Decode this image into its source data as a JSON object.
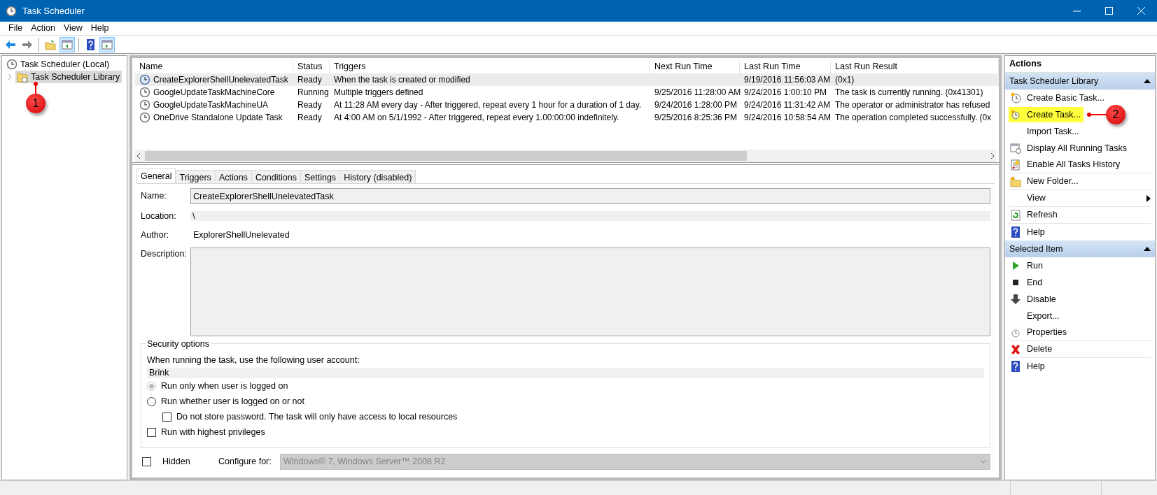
{
  "window": {
    "title": "Task Scheduler"
  },
  "menu": [
    "File",
    "Action",
    "View",
    "Help"
  ],
  "toolbar": [
    {
      "kind": "back",
      "on": false
    },
    {
      "kind": "forward",
      "on": false
    },
    {
      "kind": "sep"
    },
    {
      "kind": "up",
      "on": false
    },
    {
      "kind": "tree-pane",
      "on": true
    },
    {
      "kind": "sep"
    },
    {
      "kind": "help",
      "on": false
    },
    {
      "kind": "action-pane",
      "on": true
    }
  ],
  "tree": [
    {
      "label": "Task Scheduler (Local)",
      "selected": false,
      "children": [
        {
          "label": "Task Scheduler Library",
          "selected": true,
          "expanded": false,
          "callout": "1"
        }
      ]
    }
  ],
  "tasks": {
    "columns": [
      "Name",
      "Status",
      "Triggers",
      "Next Run Time",
      "Last Run Time",
      "Last Run Result"
    ],
    "rows": [
      {
        "selected": true,
        "cells": [
          "CreateExplorerShellUnelevatedTask",
          "Ready",
          "When the task is created or modified",
          "",
          "9/19/2016 11:56:03 AM",
          "(0x1)"
        ]
      },
      {
        "selected": false,
        "cells": [
          "GoogleUpdateTaskMachineCore",
          "Running",
          "Multiple triggers defined",
          "9/25/2016 11:28:00 AM",
          "9/24/2016 1:00:10 PM",
          "The task is currently running. (0x41301)"
        ]
      },
      {
        "selected": false,
        "cells": [
          "GoogleUpdateTaskMachineUA",
          "Ready",
          "At 11:28 AM every day - After triggered, repeat every 1 hour for a duration of 1 day.",
          "9/24/2016 1:28:00 PM",
          "9/24/2016 11:31:42 AM",
          "The operator or administrator has refused"
        ]
      },
      {
        "selected": false,
        "cells": [
          "OneDrive Standalone Update Task",
          "Ready",
          "At 4:00 AM on 5/1/1992 - After triggered, repeat every 1.00:00:00 indefinitely.",
          "9/25/2016 8:25:36 PM",
          "9/24/2016 10:58:54 AM",
          "The operation completed successfully. (0x"
        ]
      }
    ]
  },
  "detail_tabs": [
    {
      "label": "General",
      "selected": true
    },
    {
      "label": "Triggers",
      "selected": false
    },
    {
      "label": "Actions",
      "selected": false
    },
    {
      "label": "Conditions",
      "selected": false
    },
    {
      "label": "Settings",
      "selected": false
    },
    {
      "label": "History (disabled)",
      "selected": false
    }
  ],
  "general": {
    "name_label": "Name:",
    "name": "CreateExplorerShellUnelevatedTask",
    "location_label": "Location:",
    "location": "\\",
    "author_label": "Author:",
    "author": "ExplorerShellUnelevated",
    "description_label": "Description:",
    "security": {
      "title": "Security options",
      "account_label": "When running the task, use the following user account:",
      "account": "Brink",
      "options": [
        {
          "kind": "radio",
          "label": "Run only when user is logged on",
          "checked": true,
          "disabled": true
        },
        {
          "kind": "radio",
          "label": "Run whether user is logged on or not",
          "checked": false,
          "disabled": false,
          "children": [
            {
              "kind": "checkbox",
              "label": "Do not store password.  The task will only have access to local resources",
              "checked": false,
              "disabled": false
            }
          ]
        },
        {
          "kind": "checkbox",
          "label": "Run with highest privileges",
          "checked": false,
          "disabled": false
        }
      ]
    },
    "hidden": {
      "label": "Hidden",
      "checked": false
    },
    "configure_label": "Configure for:",
    "configure": {
      "value": "Windows® 7, Windows Server™ 2008 R2",
      "disabled": true
    }
  },
  "actions": {
    "title": "Actions",
    "groups": [
      {
        "title": "Task Scheduler Library",
        "expanded": true,
        "items": [
          {
            "label": "Create Basic Task...",
            "kind": "clock-star",
            "highlighted": false,
            "submenu": false,
            "divider": false
          },
          {
            "label": "Create Task...",
            "kind": "clock-small-star",
            "highlighted": true,
            "submenu": false,
            "divider": false,
            "callout": "2"
          },
          {
            "label": "Import Task...",
            "kind": "none",
            "highlighted": false,
            "submenu": false,
            "divider": false
          },
          {
            "label": "Display All Running Tasks",
            "kind": "window-clock",
            "highlighted": false,
            "submenu": false,
            "divider": false
          },
          {
            "label": "Enable All Tasks History",
            "kind": "list-warning",
            "highlighted": false,
            "submenu": false,
            "divider": true
          },
          {
            "label": "New Folder...",
            "kind": "folder-star",
            "highlighted": false,
            "submenu": false,
            "divider": true
          },
          {
            "label": "View",
            "kind": "none",
            "highlighted": false,
            "submenu": true,
            "divider": true
          },
          {
            "label": "Refresh",
            "kind": "refresh",
            "highlighted": false,
            "submenu": false,
            "divider": true
          },
          {
            "label": "Help",
            "kind": "help",
            "highlighted": false,
            "submenu": false,
            "divider": false
          }
        ]
      },
      {
        "title": "Selected Item",
        "expanded": true,
        "items": [
          {
            "label": "Run",
            "kind": "play",
            "highlighted": false,
            "submenu": false,
            "divider": false
          },
          {
            "label": "End",
            "kind": "stop",
            "highlighted": false,
            "submenu": false,
            "divider": false
          },
          {
            "label": "Disable",
            "kind": "down-arrow",
            "highlighted": false,
            "submenu": false,
            "divider": false
          },
          {
            "label": "Export...",
            "kind": "none",
            "highlighted": false,
            "submenu": false,
            "divider": false
          },
          {
            "label": "Properties",
            "kind": "clock",
            "highlighted": false,
            "submenu": false,
            "divider": true
          },
          {
            "label": "Delete",
            "kind": "cross",
            "highlighted": false,
            "submenu": false,
            "divider": true
          },
          {
            "label": "Help",
            "kind": "help",
            "highlighted": false,
            "submenu": false,
            "divider": false
          }
        ]
      }
    ]
  }
}
